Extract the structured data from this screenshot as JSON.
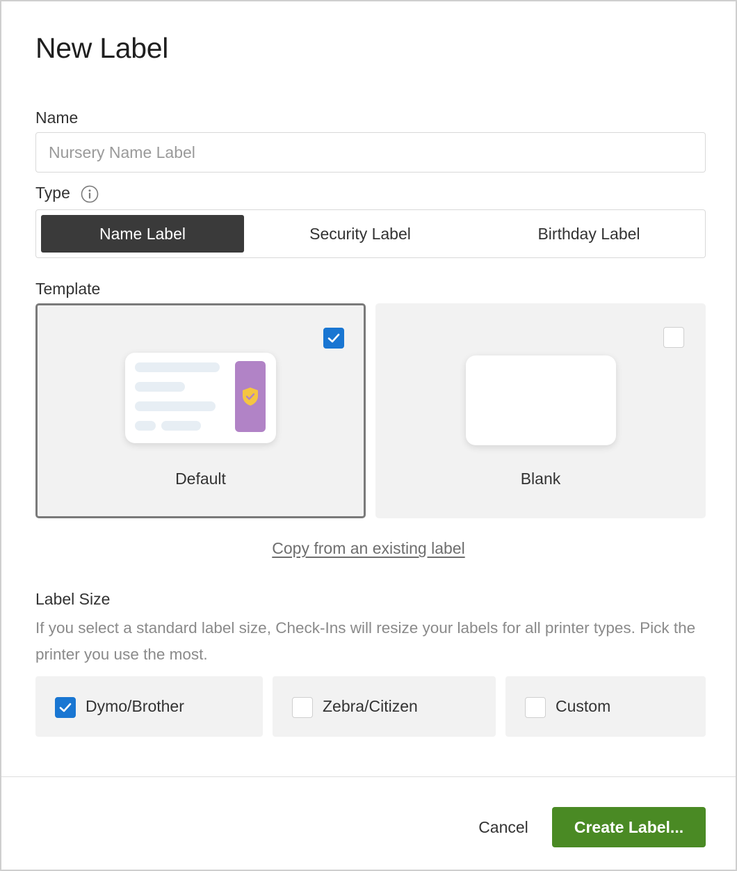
{
  "dialog": {
    "title": "New Label"
  },
  "name_field": {
    "label": "Name",
    "value": "",
    "placeholder": "Nursery Name Label"
  },
  "type_field": {
    "label": "Type",
    "options": [
      {
        "label": "Name Label",
        "selected": true
      },
      {
        "label": "Security Label",
        "selected": false
      },
      {
        "label": "Birthday Label",
        "selected": false
      }
    ]
  },
  "template_field": {
    "label": "Template",
    "options": [
      {
        "label": "Default",
        "selected": true
      },
      {
        "label": "Blank",
        "selected": false
      }
    ],
    "copy_link": "Copy from an existing label"
  },
  "label_size": {
    "label": "Label Size",
    "help": "If you select a standard label size, Check-Ins will resize your labels for all printer types. Pick the printer you use the most.",
    "options": [
      {
        "label": "Dymo/Brother",
        "checked": true
      },
      {
        "label": "Zebra/Citizen",
        "checked": false
      },
      {
        "label": "Custom",
        "checked": false
      }
    ]
  },
  "footer": {
    "cancel_label": "Cancel",
    "create_label": "Create Label..."
  },
  "colors": {
    "primary_button": "#4a8a24",
    "checkbox_checked": "#1976d2",
    "segment_active": "#3a3a3a",
    "shield_strip": "#b183c6",
    "shield_icon": "#f5c542"
  },
  "icons": {
    "type_info": "info-circle-icon",
    "checkmark": "checkmark-icon",
    "template_preview_badge": "shield-check-icon"
  }
}
